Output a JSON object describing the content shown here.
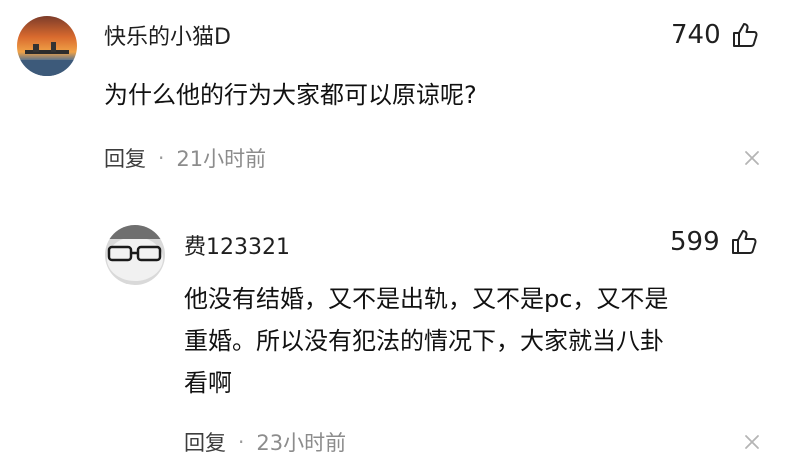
{
  "comment": {
    "username": "快乐的小猫D",
    "likes": "740",
    "text": "为什么他的行为大家都可以原谅呢?",
    "reply_label": "回复",
    "separator": "·",
    "time": "21小时前"
  },
  "reply": {
    "username": "费123321",
    "likes": "599",
    "text_line1": "他没有结婚，又不是出轨，又不是pc，又不是",
    "text_line2": "重婚。所以没有犯法的情况下，大家就当八卦",
    "text_line3": "看啊",
    "reply_label": "回复",
    "separator": "·",
    "time": "23小时前"
  },
  "icons": {
    "like": "thumbs-up-icon",
    "close": "close-icon"
  },
  "colors": {
    "text": "#1f1f1f",
    "meta": "#8c8c8c"
  }
}
